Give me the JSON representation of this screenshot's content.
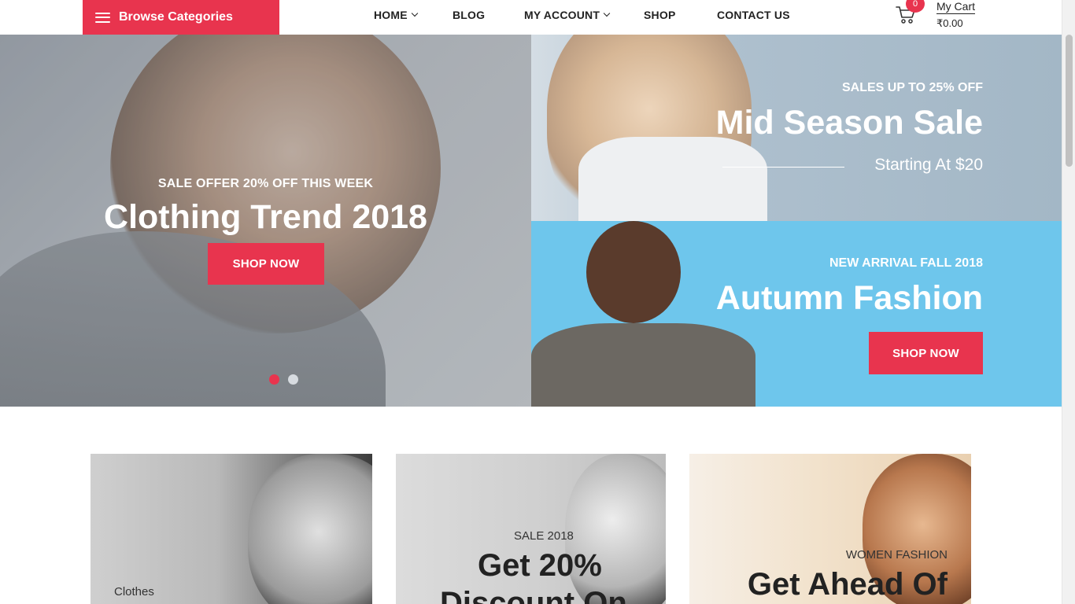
{
  "header": {
    "browse_label": "Browse Categories",
    "nav": {
      "home": "HOME",
      "blog": "BLOG",
      "my_account": "MY ACCOUNT",
      "shop": "SHOP",
      "contact": "CONTACT US"
    },
    "cart": {
      "count": "0",
      "label": "My Cart",
      "total": "₹0.00"
    }
  },
  "hero": {
    "left": {
      "subtitle": "SALE OFFER 20% OFF THIS WEEK",
      "title": "Clothing Trend 2018",
      "button": "SHOP NOW"
    },
    "right_top": {
      "subtitle": "SALES UP TO 25% OFF",
      "title": "Mid Season Sale",
      "starting": "Starting At $20"
    },
    "right_bottom": {
      "subtitle": "NEW ARRIVAL FALL 2018",
      "title": "Autumn Fashion",
      "button": "SHOP NOW"
    },
    "slider": {
      "active_dot_color": "#e8344e",
      "inactive_dot_color": "#d7dbe0"
    }
  },
  "banners": [
    {
      "small": "Clothes"
    },
    {
      "small": "SALE 2018",
      "big_line1": "Get 20%",
      "big_line2": "Discount On"
    },
    {
      "small": "WOMEN FASHION",
      "big_line1": "Get Ahead Of"
    }
  ],
  "colors": {
    "accent": "#e8344e",
    "hero_blue": "#6ec6ec"
  }
}
